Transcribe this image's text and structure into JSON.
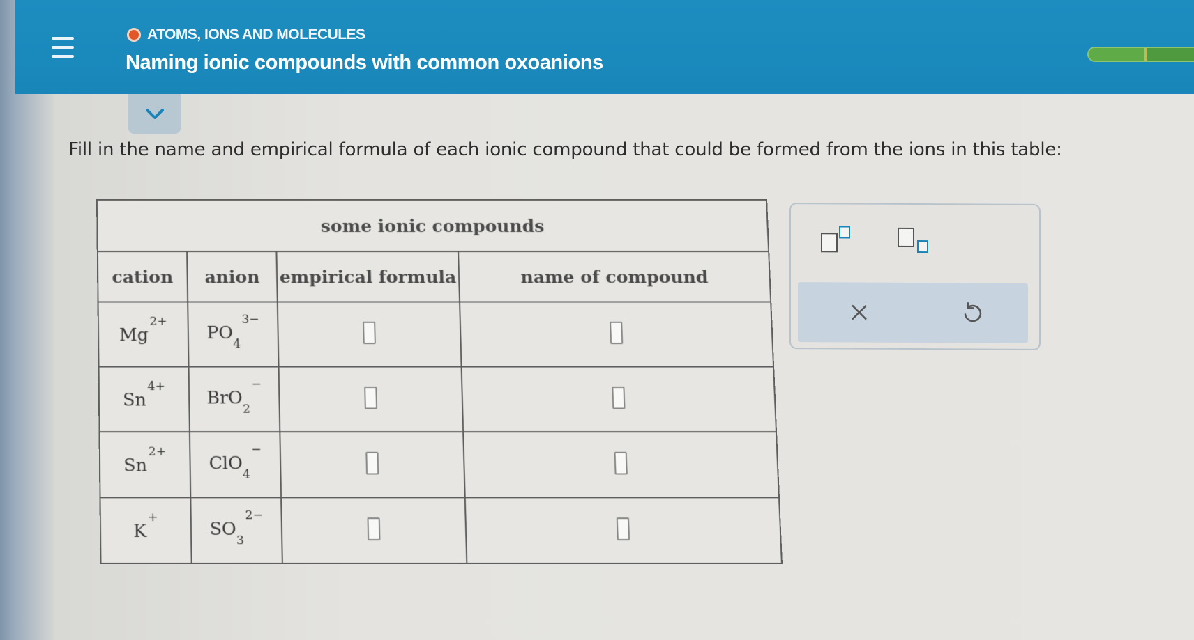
{
  "header": {
    "topic": "ATOMS, IONS AND MOLECULES",
    "title": "Naming ionic compounds with common oxoanions",
    "progress_fraction": 0.45
  },
  "instructions": "Fill in the name and empirical formula of each ionic compound that could be formed from the ions in this table:",
  "table": {
    "caption": "some ionic compounds",
    "headers": {
      "cation": "cation",
      "anion": "anion",
      "formula": "empirical formula",
      "name": "name of compound"
    },
    "rows": [
      {
        "cation": {
          "symbol": "Mg",
          "charge": "2+"
        },
        "anion": {
          "base": "PO",
          "sub": "4",
          "charge": "3−"
        }
      },
      {
        "cation": {
          "symbol": "Sn",
          "charge": "4+"
        },
        "anion": {
          "base": "BrO",
          "sub": "2",
          "charge": "−"
        }
      },
      {
        "cation": {
          "symbol": "Sn",
          "charge": "2+"
        },
        "anion": {
          "base": "ClO",
          "sub": "4",
          "charge": "−"
        }
      },
      {
        "cation": {
          "symbol": "K",
          "charge": "+"
        },
        "anion": {
          "base": "SO",
          "sub": "3",
          "charge": "2−"
        }
      }
    ]
  },
  "tools": {
    "superscript_icon": "superscript-icon",
    "subscript_icon": "subscript-icon",
    "clear_icon": "close-icon",
    "undo_icon": "undo-icon"
  },
  "colors": {
    "header_blue": "#1a8abd",
    "topic_dot": "#e0582a",
    "progress_green": "#5eab47"
  }
}
